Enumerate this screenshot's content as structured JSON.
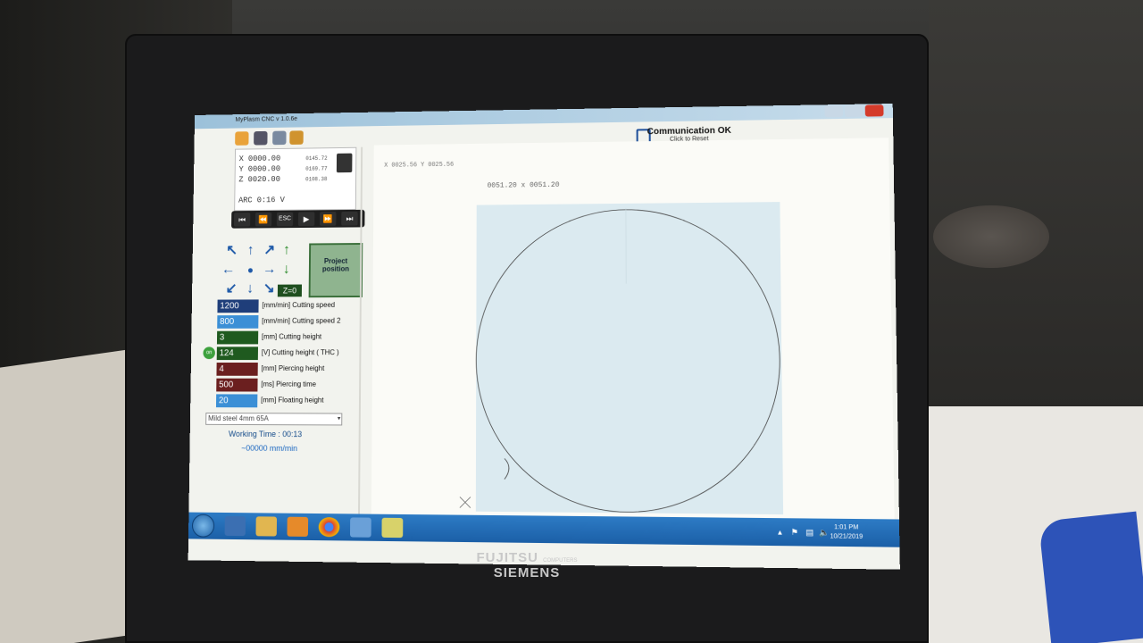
{
  "window": {
    "title": "MyPlasm CNC v 1.0.6e"
  },
  "status": {
    "communication": "Communication OK",
    "reset_hint": "Click to Reset"
  },
  "coords": {
    "x": "X  0000.00",
    "y": "Y  0000.00",
    "z": "Z  0020.00",
    "x_sub": "0145.72",
    "y_sub": "0169.77",
    "z_sub": "0108.38",
    "arc": "ARC 0:16  V"
  },
  "cursor": {
    "readout": "X 0025.56   Y 0025.56"
  },
  "part": {
    "dims": "0051.20 x  0051.20"
  },
  "transport": [
    "⏮",
    "⏪",
    "ESC",
    "▶",
    "⏩",
    "⏭"
  ],
  "jog": {
    "zero_label": "Z=0",
    "project_label": "Project position"
  },
  "params": [
    {
      "value": "1200",
      "label": "[mm/min] Cutting speed",
      "color": "#1f3e7a"
    },
    {
      "value": "800",
      "label": "[mm/min] Cutting speed 2",
      "color": "#3b8fd6"
    },
    {
      "value": "3",
      "label": "[mm] Cutting height",
      "color": "#1f5a1f"
    },
    {
      "value": "124",
      "label": "[V] Cutting height ( THC )",
      "color": "#1f5a1f"
    },
    {
      "value": "4",
      "label": "[mm] Piercing height",
      "color": "#6b1f1f"
    },
    {
      "value": "500",
      "label": "[ms] Piercing time",
      "color": "#6b1f1f"
    },
    {
      "value": "20",
      "label": "[mm] Floating height",
      "color": "#3b8fd6"
    }
  ],
  "thc_badge": "on",
  "material": {
    "selected": "Mild steel 4mm 65A"
  },
  "working_time": "Working Time : 00:13",
  "current_speed": "~00000 mm/min",
  "taskbar": {
    "time": "1:01 PM",
    "date": "10/21/2019"
  },
  "brand": {
    "name": "FUJITSU",
    "sub": "COMPUTERS",
    "name2": "SIEMENS"
  },
  "colors": {
    "taskbar": "#2270b8",
    "sheet": "#dbeaf0",
    "accent_green": "#2a8a2a"
  }
}
